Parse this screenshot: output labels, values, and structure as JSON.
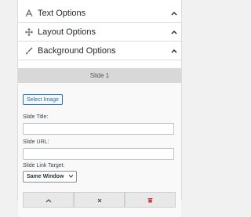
{
  "accordion": [
    {
      "label": "Text Options",
      "icon": "text-icon"
    },
    {
      "label": "Layout Options",
      "icon": "move-icon"
    },
    {
      "label": "Background Options",
      "icon": "brush-icon"
    }
  ],
  "slide": {
    "title": "Slide 1",
    "select_image_label": "Select Image",
    "title_label": "Slide Title:",
    "url_label": "Slide URL:",
    "link_target_label": "Slide Link Target:",
    "link_target_value": "Same Window",
    "actions": [
      "move-up-icon",
      "close-icon",
      "trash-icon"
    ]
  },
  "colors": {
    "accent": "#2271b1",
    "delete": "#d63638"
  }
}
